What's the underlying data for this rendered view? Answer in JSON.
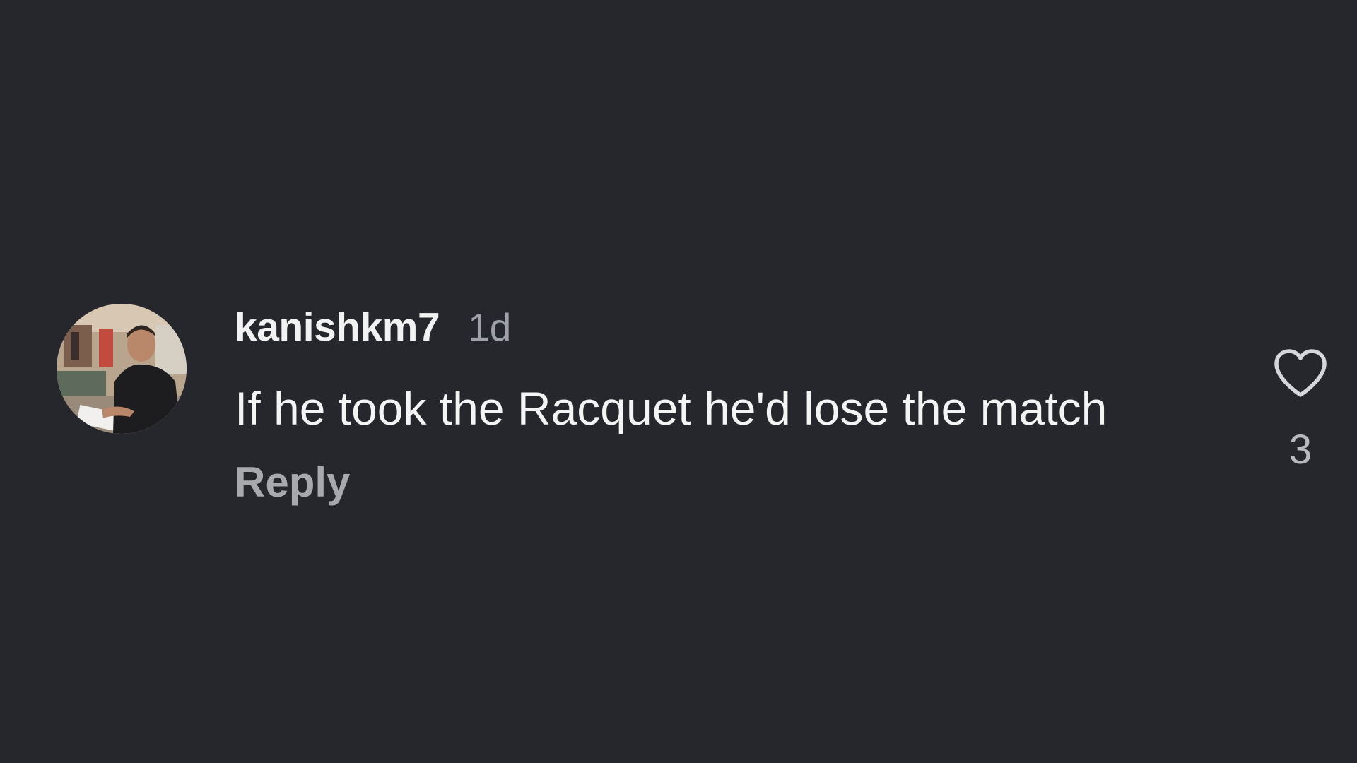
{
  "comment": {
    "username": "kanishkm7",
    "timestamp": "1d",
    "text": "If he took the Racquet he'd lose the match",
    "reply_label": "Reply",
    "like_count": "3",
    "avatar_icon": "user-avatar-photo",
    "like_icon": "heart-outline-icon"
  },
  "colors": {
    "background": "#25272c",
    "username": "#f2f2f2",
    "muted": "#9ea1a7"
  }
}
